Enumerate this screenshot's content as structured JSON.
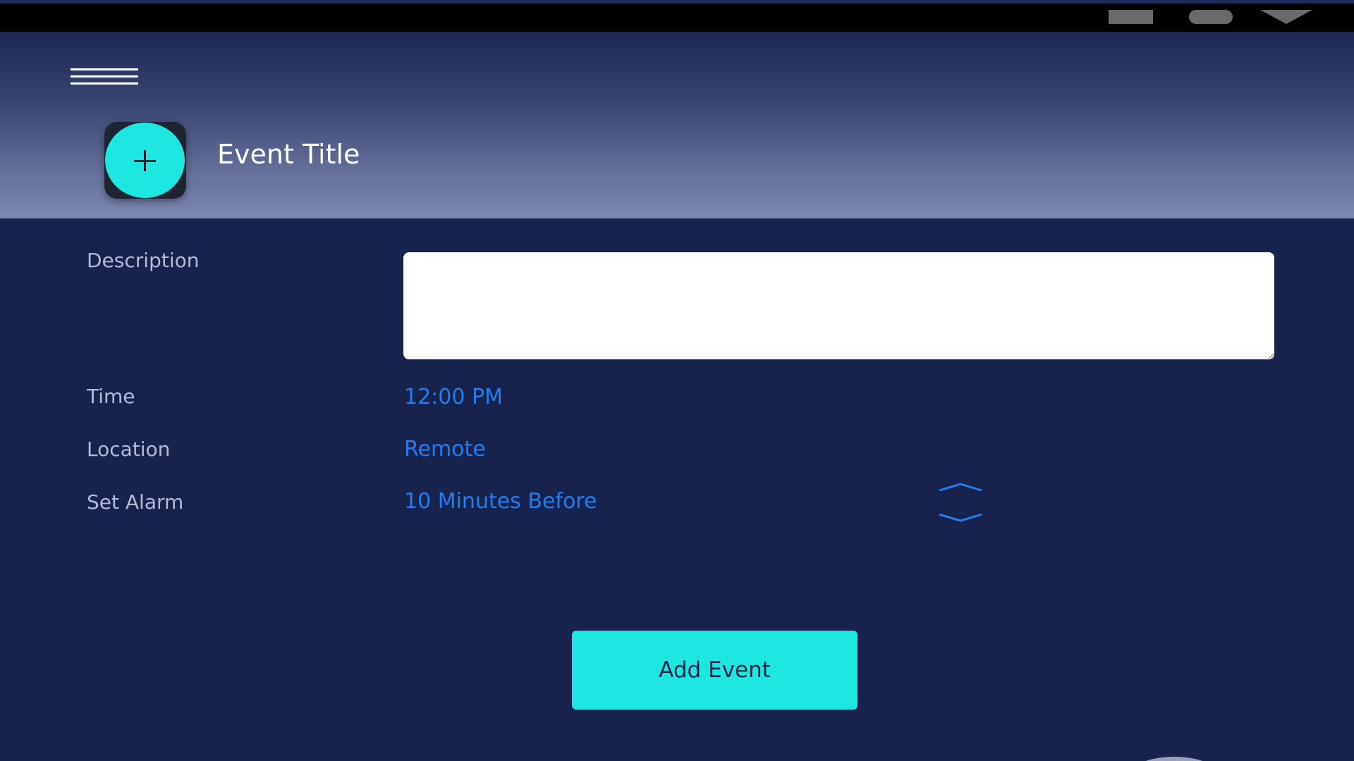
{
  "header": {
    "title": "Event Title"
  },
  "form": {
    "description_label": "Description",
    "description_value": "",
    "time_label": "Time",
    "time_value": "12:00 PM",
    "location_label": "Location",
    "location_value": "Remote",
    "alarm_label": "Set Alarm",
    "alarm_value": "10 Minutes Before"
  },
  "actions": {
    "add_event_label": "Add Event"
  },
  "icons": {
    "menu": "hamburger-menu-icon",
    "add": "plus-icon",
    "alarm_up": "chevron-up-icon",
    "alarm_down": "chevron-down-icon"
  },
  "colors": {
    "background": "#17224d",
    "accent": "#1ee6e0",
    "link": "#1f7ef2",
    "label": "#b4bbd6",
    "status_bar": "#000000"
  }
}
